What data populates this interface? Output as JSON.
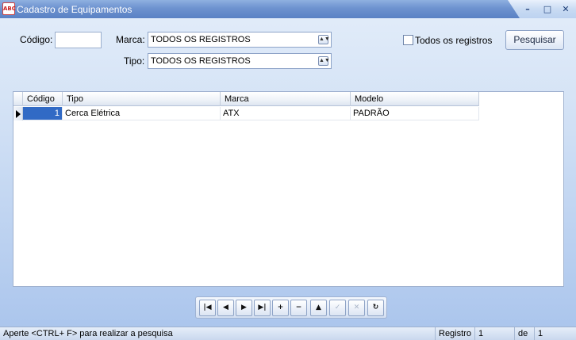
{
  "window": {
    "title": "Cadastro de Equipamentos",
    "icon_text": "ABC",
    "controls": {
      "minimize": "–",
      "maximize": "□",
      "close": "✕"
    }
  },
  "filters": {
    "codigo_label": "Código:",
    "codigo_value": "",
    "marca_label": "Marca:",
    "marca_value": "TODOS OS REGISTROS",
    "tipo_label": "Tipo:",
    "tipo_value": "TODOS OS REGISTROS",
    "todos_label": "Todos os registros",
    "todos_checked": false,
    "search_button": "Pesquisar"
  },
  "grid": {
    "columns": [
      "Código",
      "Tipo",
      "Marca",
      "Modelo"
    ],
    "rows": [
      {
        "codigo": "1",
        "tipo": "Cerca Elétrica",
        "marca": "ATX",
        "modelo": "PADRÃO"
      }
    ]
  },
  "navigator": {
    "buttons": [
      {
        "name": "first-record-icon",
        "glyph": "|◀",
        "enabled": true
      },
      {
        "name": "prior-record-icon",
        "glyph": "◀",
        "enabled": true
      },
      {
        "name": "next-record-icon",
        "glyph": "▶",
        "enabled": true
      },
      {
        "name": "last-record-icon",
        "glyph": "▶|",
        "enabled": true
      },
      {
        "name": "insert-record-icon",
        "glyph": "+",
        "enabled": true
      },
      {
        "name": "delete-record-icon",
        "glyph": "−",
        "enabled": true
      },
      {
        "name": "edit-record-icon",
        "glyph": "▲",
        "enabled": true
      },
      {
        "name": "post-record-icon",
        "glyph": "✓",
        "enabled": false
      },
      {
        "name": "cancel-record-icon",
        "glyph": "✕",
        "enabled": false
      },
      {
        "name": "refresh-icon",
        "glyph": "↻",
        "enabled": true
      }
    ]
  },
  "statusbar": {
    "hint": "Aperte <CTRL+ F> para realizar a pesquisa",
    "registro_label": "Registro",
    "registro_value": "1",
    "de_label": "de",
    "total_value": "1"
  }
}
